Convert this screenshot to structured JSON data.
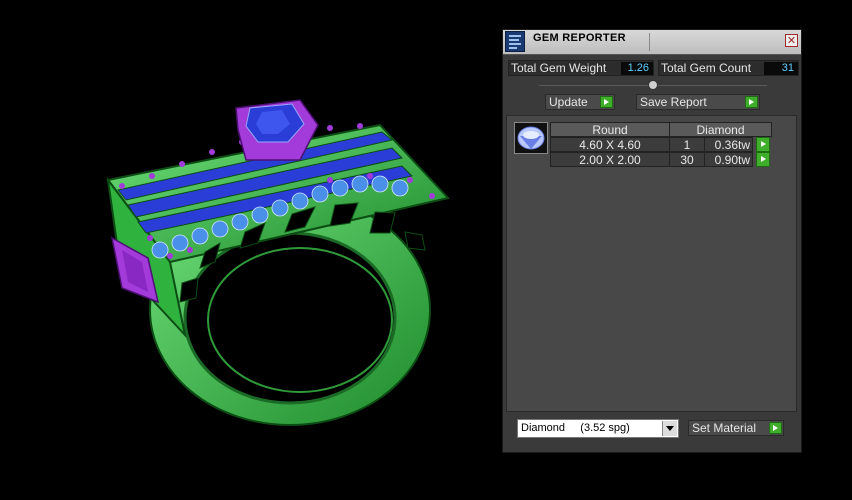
{
  "window": {
    "title": "GEM REPORTER"
  },
  "icons": {
    "app": "gem-reporter-app-icon",
    "close": "close-icon",
    "play": "play-arrow-icon",
    "gem": "round-gem-icon",
    "dropdown": "chevron-down-icon"
  },
  "stats": {
    "total_weight_label": "Total Gem Weight",
    "total_weight_value": "1.26",
    "total_count_label": "Total Gem Count",
    "total_count_value": "31"
  },
  "buttons": {
    "update": "Update",
    "save_report": "Save Report",
    "set_material": "Set Material"
  },
  "gem_table": {
    "headers": [
      "Round",
      "Diamond"
    ],
    "rows": [
      {
        "size": "4.60 X 4.60",
        "count": "1",
        "weight": "0.36tw"
      },
      {
        "size": "2.00 X 2.00",
        "count": "30",
        "weight": "0.90tw"
      }
    ]
  },
  "material_select": {
    "value": "Diamond     (3.52 spg)"
  },
  "colors": {
    "ring_metal": "#3cc84a",
    "center_stone": "#2a3dd6",
    "prongs": "#a23bd9",
    "side_stones": "#4a8fe8",
    "accent_value": "#5fd0ff",
    "play_button": "#3fae2a"
  }
}
